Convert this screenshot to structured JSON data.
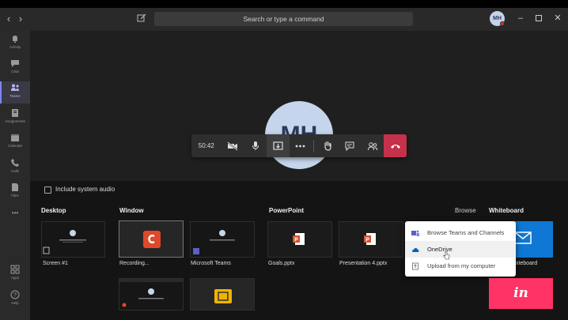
{
  "titlebar": {
    "search_placeholder": "Search or type a command",
    "avatar_initials": "MH",
    "back_icon": "chevron-left-icon",
    "forward_icon": "chevron-right-icon",
    "compose_icon": "compose-icon",
    "window_controls": [
      "minimize-icon",
      "maximize-icon",
      "close-icon"
    ]
  },
  "sidebar": {
    "items": [
      {
        "label": "Activity",
        "icon": "bell-icon"
      },
      {
        "label": "Chat",
        "icon": "chat-icon"
      },
      {
        "label": "Teams",
        "icon": "teams-icon",
        "active": true
      },
      {
        "label": "Assignments",
        "icon": "assignments-icon"
      },
      {
        "label": "Calendar",
        "icon": "calendar-icon"
      },
      {
        "label": "Calls",
        "icon": "phone-icon"
      },
      {
        "label": "Files",
        "icon": "file-icon"
      }
    ],
    "more_label": "•••",
    "bottom": [
      {
        "label": "Apps",
        "icon": "apps-icon"
      },
      {
        "label": "Help",
        "icon": "help-icon"
      }
    ]
  },
  "call": {
    "avatar_initials": "MH",
    "timer": "50:42",
    "controls": [
      {
        "name": "camera-off",
        "icon": "video-off-icon"
      },
      {
        "name": "mic",
        "icon": "microphone-icon"
      },
      {
        "name": "share",
        "icon": "share-tray-icon"
      },
      {
        "name": "more",
        "icon": "ellipsis-icon"
      },
      {
        "name": "raise-hand",
        "icon": "hand-icon"
      },
      {
        "name": "chat",
        "icon": "chat-bubble-icon"
      },
      {
        "name": "participants",
        "icon": "people-icon"
      },
      {
        "name": "hang-up",
        "icon": "hang-up-icon"
      }
    ],
    "accent": "#c4314b"
  },
  "share_tray": {
    "include_audio_label": "Include system audio",
    "sections": {
      "desktop": "Desktop",
      "window": "Window",
      "powerpoint": "PowerPoint",
      "browse": "Browse",
      "whiteboard": "Whiteboard"
    },
    "desktop_items": [
      {
        "caption": "Screen #1"
      }
    ],
    "window_items": [
      {
        "caption": "Recording..."
      },
      {
        "caption": "Microsoft Teams"
      }
    ],
    "powerpoint_items": [
      {
        "caption": "Goals.pptx"
      },
      {
        "caption": "Presentation 4.pptx"
      }
    ],
    "whiteboard_caption": "Whiteboard",
    "whiteboard_caption_visible": "Whiteboard",
    "browse_menu": [
      {
        "label": "Browse Teams and Channels",
        "icon": "teams-icon"
      },
      {
        "label": "OneDrive",
        "icon": "onedrive-icon",
        "hovered": true
      },
      {
        "label": "Upload from my computer",
        "icon": "upload-icon"
      }
    ],
    "invision_label": "in"
  }
}
